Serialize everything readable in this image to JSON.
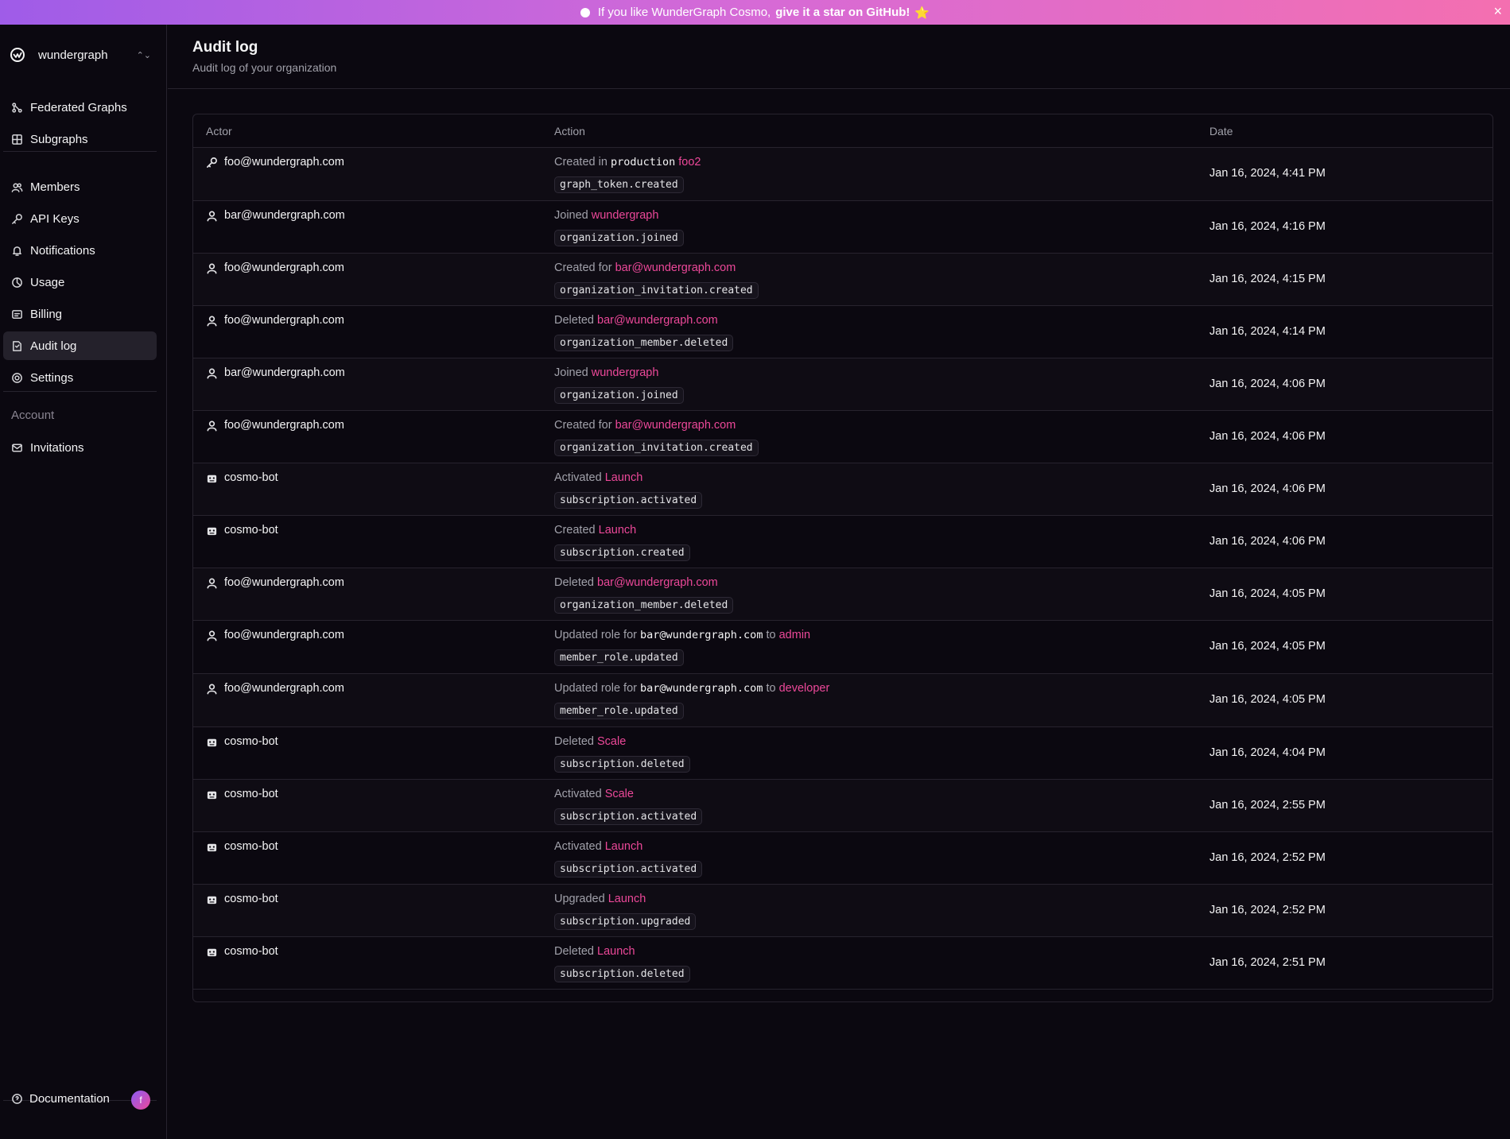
{
  "banner": {
    "prefix": "If you like WunderGraph Cosmo,",
    "link": "give it a star on GitHub!",
    "star": "⭐",
    "close": "×"
  },
  "org": {
    "name": "wundergraph"
  },
  "sidebar": {
    "items": [
      {
        "label": "Federated Graphs",
        "icon": "graph-icon"
      },
      {
        "label": "Subgraphs",
        "icon": "grid-icon"
      },
      {
        "label": "Members",
        "icon": "users-icon"
      },
      {
        "label": "API Keys",
        "icon": "key-icon"
      },
      {
        "label": "Notifications",
        "icon": "bell-icon"
      },
      {
        "label": "Usage",
        "icon": "usage-icon"
      },
      {
        "label": "Billing",
        "icon": "billing-icon"
      },
      {
        "label": "Audit log",
        "icon": "audit-icon",
        "active": true
      },
      {
        "label": "Settings",
        "icon": "gear-icon"
      }
    ],
    "account_label": "Account",
    "account_items": [
      {
        "label": "Invitations",
        "icon": "mail-icon"
      }
    ],
    "docs_label": "Documentation",
    "avatar_initial": "f"
  },
  "page": {
    "title": "Audit log",
    "subtitle": "Audit log of your organization"
  },
  "table": {
    "headers": {
      "actor": "Actor",
      "action": "Action",
      "date": "Date"
    },
    "rows": [
      {
        "actor": "foo@wundergraph.com",
        "actor_icon": "key-icon",
        "verb": "Created",
        "mid": "in",
        "mono": "production",
        "target": "foo2",
        "event": "graph_token.created",
        "date": "Jan 16, 2024, 4:41 PM"
      },
      {
        "actor": "bar@wundergraph.com",
        "actor_icon": "user-icon",
        "verb": "Joined",
        "target": "wundergraph",
        "event": "organization.joined",
        "date": "Jan 16, 2024, 4:16 PM"
      },
      {
        "actor": "foo@wundergraph.com",
        "actor_icon": "user-icon",
        "verb": "Created",
        "mid": "for",
        "target": "bar@wundergraph.com",
        "event": "organization_invitation.created",
        "date": "Jan 16, 2024, 4:15 PM"
      },
      {
        "actor": "foo@wundergraph.com",
        "actor_icon": "user-icon",
        "verb": "Deleted",
        "target": "bar@wundergraph.com",
        "event": "organization_member.deleted",
        "date": "Jan 16, 2024, 4:14 PM"
      },
      {
        "actor": "bar@wundergraph.com",
        "actor_icon": "user-icon",
        "verb": "Joined",
        "target": "wundergraph",
        "event": "organization.joined",
        "date": "Jan 16, 2024, 4:06 PM"
      },
      {
        "actor": "foo@wundergraph.com",
        "actor_icon": "user-icon",
        "verb": "Created",
        "mid": "for",
        "target": "bar@wundergraph.com",
        "event": "organization_invitation.created",
        "date": "Jan 16, 2024, 4:06 PM"
      },
      {
        "actor": "cosmo-bot",
        "actor_icon": "bot-icon",
        "verb": "Activated",
        "target": "Launch",
        "event": "subscription.activated",
        "date": "Jan 16, 2024, 4:06 PM"
      },
      {
        "actor": "cosmo-bot",
        "actor_icon": "bot-icon",
        "verb": "Created",
        "target": "Launch",
        "event": "subscription.created",
        "date": "Jan 16, 2024, 4:06 PM"
      },
      {
        "actor": "foo@wundergraph.com",
        "actor_icon": "user-icon",
        "verb": "Deleted",
        "target": "bar@wundergraph.com",
        "event": "organization_member.deleted",
        "date": "Jan 16, 2024, 4:05 PM"
      },
      {
        "actor": "foo@wundergraph.com",
        "actor_icon": "user-icon",
        "verb": "Updated role for",
        "mono": "bar@wundergraph.com",
        "mid2": "to",
        "target": "admin",
        "event": "member_role.updated",
        "date": "Jan 16, 2024, 4:05 PM"
      },
      {
        "actor": "foo@wundergraph.com",
        "actor_icon": "user-icon",
        "verb": "Updated role for",
        "mono": "bar@wundergraph.com",
        "mid2": "to",
        "target": "developer",
        "event": "member_role.updated",
        "date": "Jan 16, 2024, 4:05 PM"
      },
      {
        "actor": "cosmo-bot",
        "actor_icon": "bot-icon",
        "verb": "Deleted",
        "target": "Scale",
        "event": "subscription.deleted",
        "date": "Jan 16, 2024, 4:04 PM"
      },
      {
        "actor": "cosmo-bot",
        "actor_icon": "bot-icon",
        "verb": "Activated",
        "target": "Scale",
        "event": "subscription.activated",
        "date": "Jan 16, 2024, 2:55 PM"
      },
      {
        "actor": "cosmo-bot",
        "actor_icon": "bot-icon",
        "verb": "Activated",
        "target": "Launch",
        "event": "subscription.activated",
        "date": "Jan 16, 2024, 2:52 PM"
      },
      {
        "actor": "cosmo-bot",
        "actor_icon": "bot-icon",
        "verb": "Upgraded",
        "target": "Launch",
        "event": "subscription.upgraded",
        "date": "Jan 16, 2024, 2:52 PM"
      },
      {
        "actor": "cosmo-bot",
        "actor_icon": "bot-icon",
        "verb": "Deleted",
        "target": "Launch",
        "event": "subscription.deleted",
        "date": "Jan 16, 2024, 2:51 PM"
      }
    ]
  },
  "colors": {
    "accent": "#ec4899",
    "background": "#0b0810",
    "border": "#27232e"
  }
}
